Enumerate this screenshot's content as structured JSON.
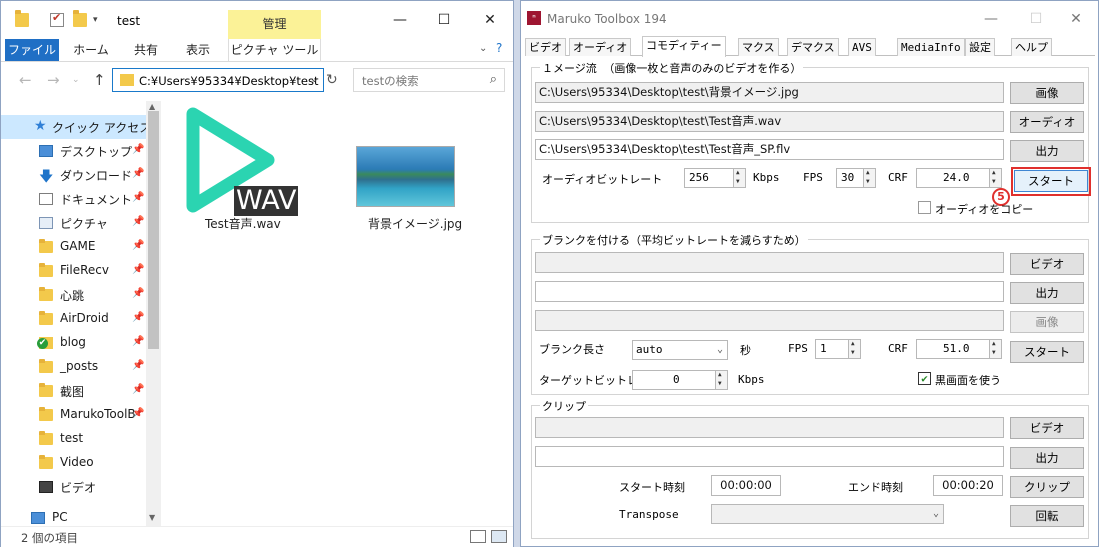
{
  "explorer": {
    "title": "test",
    "manage_tab": "管理",
    "ribbon_tabs": [
      "ファイル",
      "ホーム",
      "共有",
      "表示",
      "ピクチャ ツール"
    ],
    "address": "C:¥Users¥95334¥Desktop¥test",
    "search_placeholder": "testの検索",
    "quick_access": "クイック アクセス",
    "nav_items": [
      "デスクトップ",
      "ダウンロード",
      "ドキュメント",
      "ピクチャ",
      "GAME",
      "FileRecv",
      "心跳",
      "AirDroid",
      "blog",
      "_posts",
      "截图",
      "MarukoToolB",
      "test",
      "Video",
      "ビデオ",
      "PC"
    ],
    "files": [
      {
        "name": "Test音声.wav",
        "badge": "WAV",
        "icon": "play-triangle-icon"
      },
      {
        "name": "背景イメージ.jpg",
        "icon": "lake-image-thumbnail"
      }
    ],
    "status": "2 個の項目",
    "accent": "#1f6fc5"
  },
  "maruko": {
    "title": "Maruko Toolbox 194",
    "tabs": [
      "ビデオ",
      "オーディオ",
      "コモディティー",
      "マクス",
      "デマクス",
      "AVS",
      "MediaInfo",
      "設定",
      "ヘルプ"
    ],
    "image_stream": {
      "title": "１メージ流 （画像一枚と音声のみのビデオを作る）",
      "image_path": "C:\\Users\\95334\\Desktop\\test\\背景イメージ.jpg",
      "audio_path": "C:\\Users\\95334\\Desktop\\test\\Test音声.wav",
      "output_path": "C:\\Users\\95334\\Desktop\\test\\Test音声_SP.flv",
      "btn_image": "画像",
      "btn_audio": "オーディオ",
      "btn_output": "出力",
      "bitrate_label": "オーディオビットレート",
      "bitrate": "256",
      "kbps": "Kbps",
      "fps_label": "FPS",
      "fps": "30",
      "crf_label": "CRF",
      "crf": "24.0",
      "btn_start": "スタート",
      "copy_audio": "オーディオをコピー",
      "marker": "5"
    },
    "blank": {
      "title": "ブランクを付ける（平均ビットレートを減らすため）",
      "btn_video": "ビデオ",
      "btn_output": "出力",
      "btn_image": "画像",
      "length_label": "ブランク長さ",
      "length": "auto",
      "sec": "秒",
      "fps_label": "FPS",
      "fps": "1",
      "crf_label": "CRF",
      "crf": "51.0",
      "btn_start": "スタート",
      "target_label": "ターゲットビットレート",
      "target": "0",
      "kbps": "Kbps",
      "black_label": "黒画面を使う"
    },
    "clip": {
      "title": "クリップ",
      "btn_video": "ビデオ",
      "btn_output": "出力",
      "start_label": "スタート時刻",
      "start": "00:00:00",
      "end_label": "エンド時刻",
      "end": "00:00:20",
      "btn_clip": "クリップ",
      "transpose_label": "Transpose",
      "btn_rotate": "回転"
    }
  }
}
